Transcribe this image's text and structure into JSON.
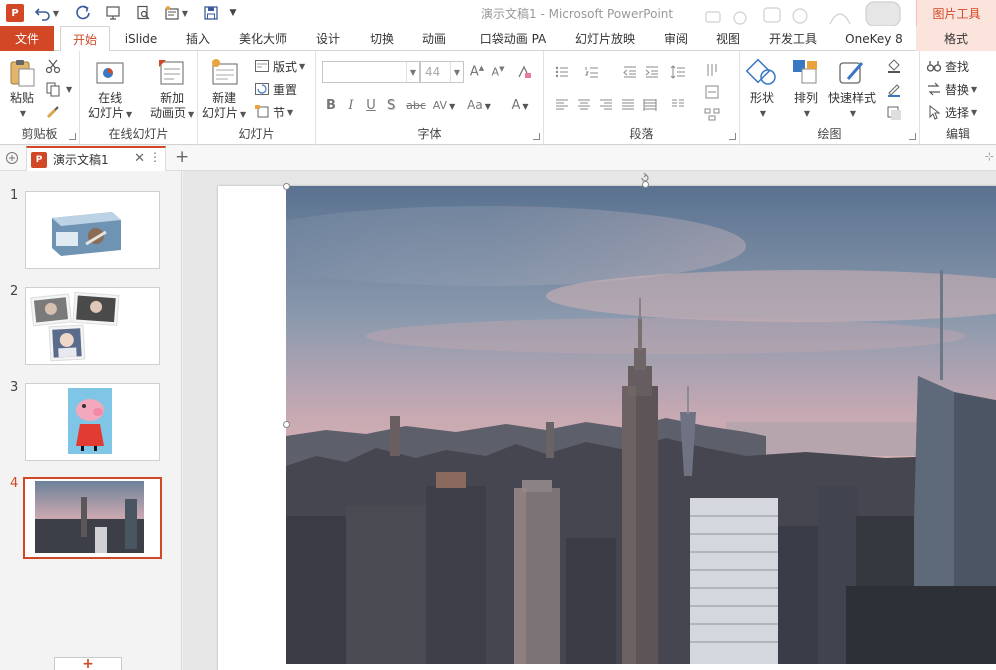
{
  "window": {
    "title": "演示文稿1 - Microsoft PowerPoint",
    "context_tool": "图片工具"
  },
  "tabs": {
    "file": "文件",
    "home": "开始",
    "islide": "iSlide",
    "insert": "插入",
    "beautify": "美化大师",
    "design": "设计",
    "transitions": "切换",
    "animations": "动画",
    "pocket": "口袋动画 PA",
    "slideshow": "幻灯片放映",
    "review": "审阅",
    "view": "视图",
    "developer": "开发工具",
    "onekey": "OneKey 8",
    "format": "格式"
  },
  "ribbon": {
    "clipboard": {
      "paste": "粘贴",
      "label": "剪贴板"
    },
    "online": {
      "online_slides_1": "在线",
      "online_slides_2": "幻灯片",
      "new_page_1": "新加",
      "new_page_2": "动画页",
      "label": "在线幻灯片"
    },
    "slides": {
      "new_slide_1": "新建",
      "new_slide_2": "幻灯片",
      "layout": "版式",
      "reset": "重置",
      "section": "节",
      "label": "幻灯片"
    },
    "font": {
      "font_name": "",
      "font_size": "44",
      "label": "字体"
    },
    "paragraph": {
      "label": "段落"
    },
    "drawing": {
      "shapes": "形状",
      "arrange": "排列",
      "quick_styles": "快速样式",
      "label": "绘图"
    },
    "editing": {
      "find": "查找",
      "replace": "替换",
      "select": "选择",
      "label": "编辑"
    }
  },
  "document_tab": {
    "name": "演示文稿1"
  },
  "thumbnails": {
    "items": [
      {
        "number": "1"
      },
      {
        "number": "2"
      },
      {
        "number": "3"
      },
      {
        "number": "4"
      }
    ],
    "selected": 4,
    "add_label": "+"
  },
  "colors": {
    "accent": "#d24726",
    "context_bg": "#fbe4dc"
  }
}
